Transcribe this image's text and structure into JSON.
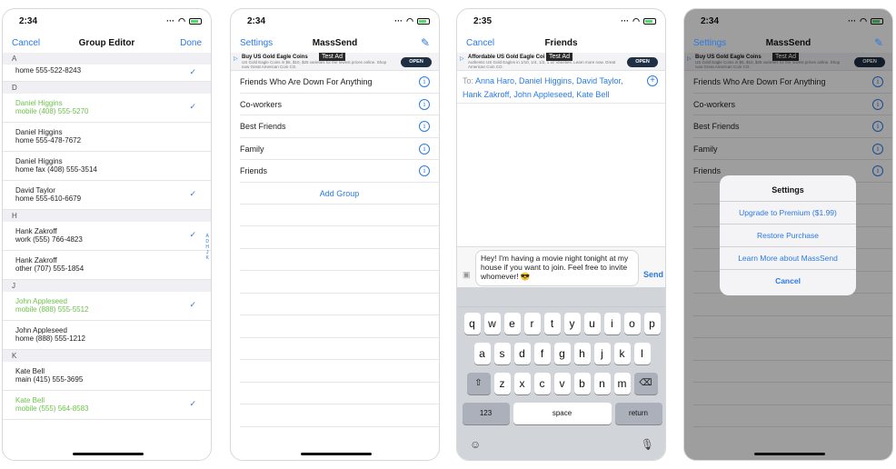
{
  "screen1": {
    "time": "2:34",
    "cancel": "Cancel",
    "title": "Group Editor",
    "done": "Done",
    "sections": [
      {
        "letter": "A",
        "rows": [
          {
            "name": "",
            "phone": "home 555-522-8243",
            "checked": true,
            "green": false
          }
        ]
      },
      {
        "letter": "D",
        "rows": [
          {
            "name": "Daniel Higgins",
            "phone": "mobile (408) 555-5270",
            "checked": true,
            "green": true
          },
          {
            "name": "Daniel Higgins",
            "phone": "home 555-478-7672",
            "checked": false,
            "green": false
          },
          {
            "name": "Daniel Higgins",
            "phone": "home fax (408) 555-3514",
            "checked": false,
            "green": false
          },
          {
            "name": "David Taylor",
            "phone": "home 555-610-6679",
            "checked": true,
            "green": false
          }
        ]
      },
      {
        "letter": "H",
        "rows": [
          {
            "name": "Hank Zakroff",
            "phone": "work (555) 766-4823",
            "checked": true,
            "green": false
          },
          {
            "name": "Hank Zakroff",
            "phone": "other (707) 555-1854",
            "checked": false,
            "green": false
          }
        ]
      },
      {
        "letter": "J",
        "rows": [
          {
            "name": "John Appleseed",
            "phone": "mobile (888) 555-5512",
            "checked": true,
            "green": true
          },
          {
            "name": "John Appleseed",
            "phone": "home (888) 555-1212",
            "checked": false,
            "green": false
          }
        ]
      },
      {
        "letter": "K",
        "rows": [
          {
            "name": "Kate Bell",
            "phone": "main (415) 555-3695",
            "checked": false,
            "green": false
          },
          {
            "name": "Kate Bell",
            "phone": "mobile (555) 564-8583",
            "checked": true,
            "green": true
          }
        ]
      }
    ],
    "index_letters": [
      "A",
      "D",
      "H",
      "J",
      "K"
    ]
  },
  "screen2": {
    "time": "2:34",
    "settings": "Settings",
    "title": "MassSend",
    "groups": [
      "Friends Who Are Down For Anything",
      "Co-workers",
      "Best Friends",
      "Family",
      "Friends"
    ],
    "add_group": "Add Group"
  },
  "ad1": {
    "title": "Buy US Gold Eagle Coins",
    "text": "US Gold Eagle Coins in $5, $10, $25 varieties for the lowest prices online. Shop now Great American Coin CO.",
    "open": "OPEN",
    "test": "Test Ad"
  },
  "ad2": {
    "title": "Affordable US Gold Eagle Coi",
    "text": "Authentic US Gold Eagles in 1/10, 1/4, 1/2, 1 oz Varieties. Learn more now. Great American Coin CO.",
    "open": "OPEN",
    "test": "Test Ad"
  },
  "screen3": {
    "time": "2:35",
    "cancel": "Cancel",
    "title": "Friends",
    "to_label": "To:",
    "recipients": "Anna Haro, Daniel Higgins, David Taylor, Hank Zakroff, John Appleseed, Kate Bell",
    "message": "Hey! I'm having a movie night tonight at my house if you want to join. Feel free to invite whomever! 😎",
    "send": "Send",
    "keys_row1": [
      "q",
      "w",
      "e",
      "r",
      "t",
      "y",
      "u",
      "i",
      "o",
      "p"
    ],
    "keys_row2": [
      "a",
      "s",
      "d",
      "f",
      "g",
      "h",
      "j",
      "k",
      "l"
    ],
    "keys_row3": [
      "z",
      "x",
      "c",
      "v",
      "b",
      "n",
      "m"
    ],
    "key_123": "123",
    "key_space": "space",
    "key_return": "return"
  },
  "screen4": {
    "time": "2:34",
    "alert_title": "Settings",
    "options": [
      "Upgrade to Premium ($1.99)",
      "Restore Purchase",
      "Learn More about MassSend"
    ],
    "cancel": "Cancel"
  },
  "colors": {
    "accent": "#2a7ae2",
    "green": "#6cc24a"
  }
}
